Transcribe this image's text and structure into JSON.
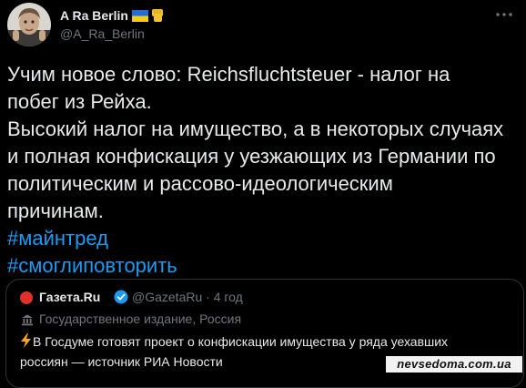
{
  "author": {
    "display_name": "A Ra Berlin",
    "handle": "@A_Ra_Berlin",
    "avatar_icon": "avatar-photo"
  },
  "tweet": {
    "lines": [
      "Учим новое слово: Reichsfluchtsteuer - налог на",
      "побег из Рейха.",
      "Высокий налог на имущество, а в некоторых случаях",
      "и полная конфискация у уезжающих из Германии по",
      "политическим и рассово-идеологическим",
      "причинам."
    ],
    "hashtags": [
      "#майнтред",
      "#смоглиповторить"
    ]
  },
  "quoted": {
    "source_name": "Газета.Ru",
    "handle": "@GazetaRu",
    "separator": "·",
    "time": "4 год",
    "label": "Государственное издание, Россия",
    "text": "В Госдуме готовят проект о конфискации имущества у ряда уехавших россиян — источник РИА Новости"
  },
  "watermark": "nevsedoma.com.ua",
  "colors": {
    "background": "#000000",
    "text": "#e7e9ea",
    "secondary": "#71767b",
    "hashtag": "#1d9bf0",
    "verified": "#1d9bf0",
    "border": "#2f3336"
  },
  "icons": [
    "ukraine-flag-icon",
    "raised-fist-icon",
    "more-icon",
    "verified-badge-icon",
    "government-icon",
    "lightning-icon"
  ]
}
